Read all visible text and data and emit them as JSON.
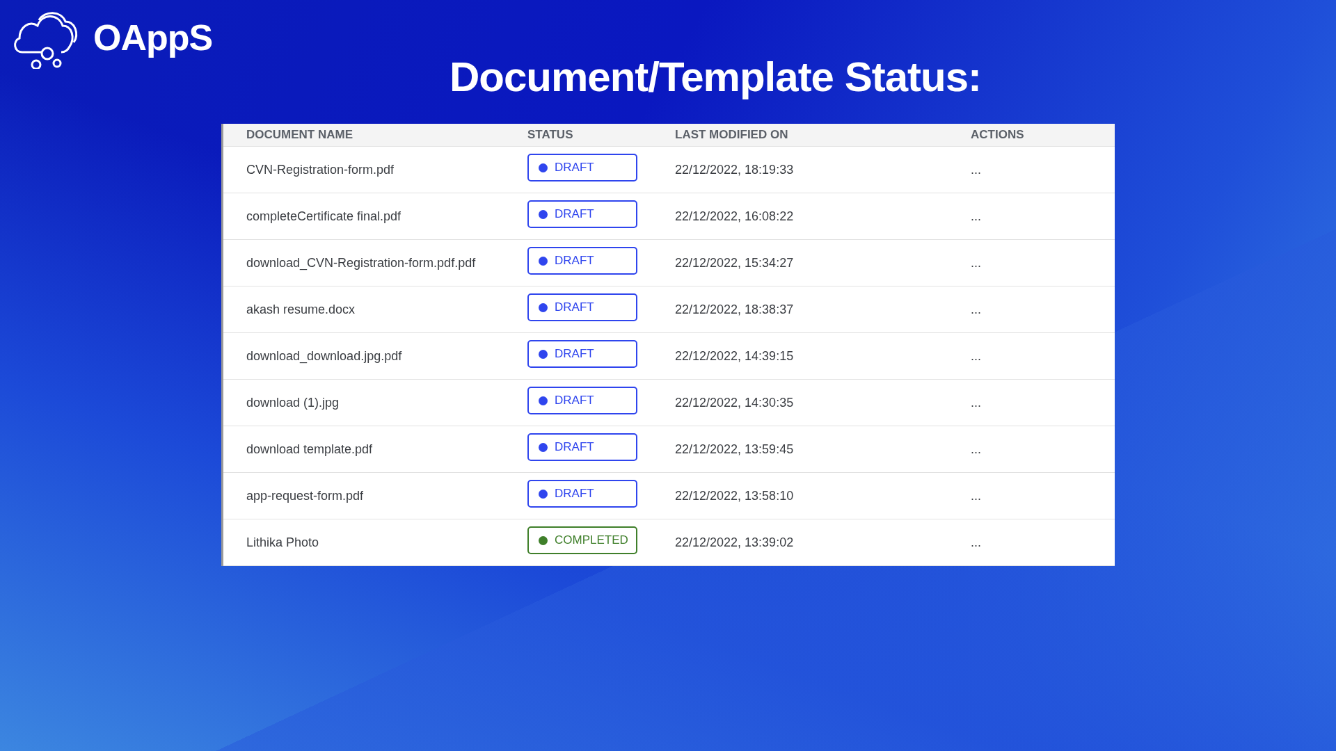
{
  "brand": {
    "name": "OAppS"
  },
  "title": "Document/Template Status:",
  "table": {
    "columns": [
      "DOCUMENT NAME",
      "STATUS",
      "LAST MODIFIED ON",
      "ACTIONS"
    ],
    "rows": [
      {
        "name": "CVN-Registration-form.pdf",
        "status": "DRAFT",
        "color": "#2f45ee",
        "modified": "22/12/2022, 18:19:33",
        "actions": "..."
      },
      {
        "name": "completeCertificate final.pdf",
        "status": "DRAFT",
        "color": "#2f45ee",
        "modified": "22/12/2022, 16:08:22",
        "actions": "..."
      },
      {
        "name": "download_CVN-Registration-form.pdf.pdf",
        "status": "DRAFT",
        "color": "#2f45ee",
        "modified": "22/12/2022, 15:34:27",
        "actions": "..."
      },
      {
        "name": "akash resume.docx",
        "status": "DRAFT",
        "color": "#2f45ee",
        "modified": "22/12/2022, 18:38:37",
        "actions": "..."
      },
      {
        "name": "download_download.jpg.pdf",
        "status": "DRAFT",
        "color": "#2f45ee",
        "modified": "22/12/2022, 14:39:15",
        "actions": "..."
      },
      {
        "name": "download (1).jpg",
        "status": "DRAFT",
        "color": "#2f45ee",
        "modified": "22/12/2022, 14:30:35",
        "actions": "..."
      },
      {
        "name": "download template.pdf",
        "status": "DRAFT",
        "color": "#2f45ee",
        "modified": "22/12/2022, 13:59:45",
        "actions": "..."
      },
      {
        "name": "app-request-form.pdf",
        "status": "DRAFT",
        "color": "#2f45ee",
        "modified": "22/12/2022, 13:58:10",
        "actions": "..."
      },
      {
        "name": "Lithika Photo",
        "status": "COMPLETED",
        "color": "#3f7f2a",
        "modified": "22/12/2022, 13:39:02",
        "actions": "..."
      }
    ]
  }
}
